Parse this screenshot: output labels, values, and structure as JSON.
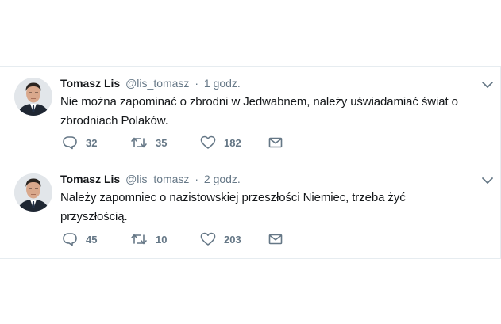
{
  "tweets": [
    {
      "name": "Tomasz Lis",
      "handle": "@lis_tomasz",
      "separator": "·",
      "time": "1 godz.",
      "text": "Nie można zapominać o zbrodni w Jedwabnem, należy uświadamiać świat o zbrodniach Polaków.",
      "replies": "32",
      "retweets": "35",
      "likes": "182"
    },
    {
      "name": "Tomasz Lis",
      "handle": "@lis_tomasz",
      "separator": "·",
      "time": "2 godz.",
      "text": "Należy zapomniec o nazistowskiej przeszłości Niemiec, trzeba żyć przyszłością.",
      "replies": "45",
      "retweets": "10",
      "likes": "203"
    }
  ],
  "icons": {
    "reply": "reply-icon",
    "retweet": "retweet-icon",
    "like": "heart-icon",
    "message": "envelope-icon",
    "menu": "chevron-down-icon"
  },
  "colors": {
    "text": "#14171a",
    "secondary": "#657786",
    "border": "#e6ecf0"
  }
}
